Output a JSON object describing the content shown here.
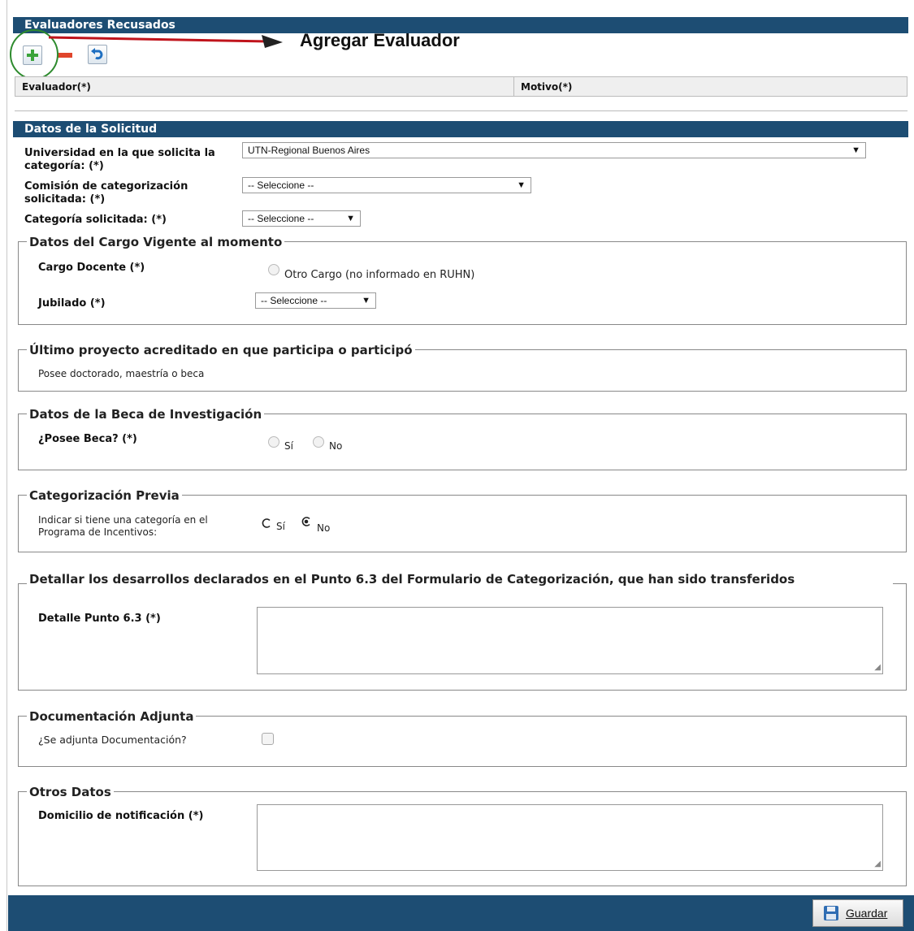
{
  "evaluadores": {
    "title": "Evaluadores Recusados",
    "annotation": "Agregar Evaluador",
    "col_evaluador": "Evaluador(*)",
    "col_motivo": "Motivo(*)"
  },
  "solicitud": {
    "title": "Datos de la Solicitud",
    "universidad_label": "Universidad en la que solicita la categoría: (*)",
    "universidad_value": "UTN-Regional Buenos Aires",
    "comision_label": "Comisión de categorización solicitada: (*)",
    "comision_value": "-- Seleccione --",
    "categoria_label": "Categoría solicitada: (*)",
    "categoria_value": "-- Seleccione --"
  },
  "cargo": {
    "legend": "Datos del Cargo Vigente al momento",
    "cargo_label": "Cargo Docente (*)",
    "otro_cargo": "Otro Cargo (no informado en RUHN)",
    "jubilado_label": "Jubilado (*)",
    "jubilado_value": "-- Seleccione --"
  },
  "proyecto": {
    "legend": "Último proyecto acreditado en que participa o participó",
    "text": "Posee doctorado, maestría o beca"
  },
  "beca": {
    "legend": "Datos de la Beca de Investigación",
    "label": "¿Posee Beca? (*)",
    "si": "Sí",
    "no": "No"
  },
  "previa": {
    "legend": "Categorización Previa",
    "label": "Indicar si tiene una categoría en el Programa de Incentivos:",
    "si": "Sí",
    "no": "No",
    "selected": "No"
  },
  "desarrollos": {
    "legend": "Detallar los desarrollos declarados en el Punto 6.3 del Formulario de Categorización, que han sido transferidos",
    "label": "Detalle Punto 6.3 (*)",
    "value": ""
  },
  "documentacion": {
    "legend": "Documentación Adjunta",
    "label": "¿Se adjunta Documentación?",
    "checked": false
  },
  "otros": {
    "legend": "Otros Datos",
    "label": "Domicilio de notificación (*)",
    "value": ""
  },
  "footer": {
    "save_label": "Guardar"
  },
  "colors": {
    "header_bar": "#1d4d73",
    "annotation_arrow": "#c0141c",
    "annotation_circle": "#2e8b2e"
  }
}
